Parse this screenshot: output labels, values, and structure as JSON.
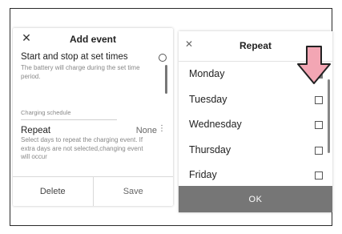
{
  "add_event": {
    "title": "Add event",
    "close_glyph": "✕",
    "start_stop": {
      "title": "Start and stop at set times",
      "description": "The battery will charge during the set time period."
    },
    "section_label": "Charging schedule",
    "repeat": {
      "title": "Repeat",
      "value": "None",
      "description": "Select days to repeat the charging event. If extra days are not selected,changing event will occur"
    },
    "delete_label": "Delete",
    "save_label": "Save"
  },
  "repeat_dialog": {
    "title": "Repeat",
    "close_glyph": "✕",
    "days": [
      {
        "label": "Monday",
        "checked": true
      },
      {
        "label": "Tuesday",
        "checked": false
      },
      {
        "label": "Wednesday",
        "checked": false
      },
      {
        "label": "Thursday",
        "checked": false
      },
      {
        "label": "Friday",
        "checked": false
      }
    ],
    "ok_label": "OK"
  },
  "colors": {
    "arrow_fill": "#f3a6b4",
    "arrow_stroke": "#222222",
    "ok_button": "#767676",
    "checked_box": "#7a7a7a"
  },
  "icons": {
    "close": "close-icon",
    "radio": "radio-icon",
    "kebab": "more-vertical-icon",
    "arrow": "down-arrow-icon"
  }
}
